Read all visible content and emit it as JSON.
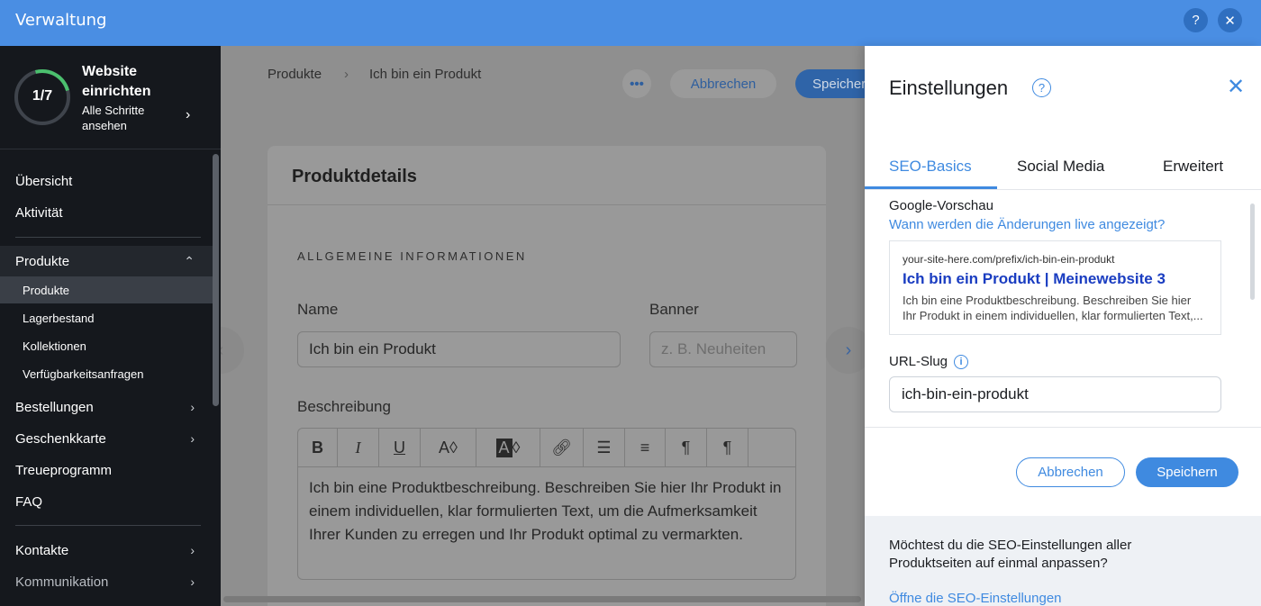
{
  "topbar": {
    "title": "Verwaltung",
    "help_icon": "?",
    "close_icon": "✕"
  },
  "sidebar": {
    "setup": {
      "progress": "1/7",
      "progress_fraction": 0.143,
      "title": "Website einrichten",
      "subtitle": "Alle Schritte ansehen"
    },
    "items": [
      {
        "label": "Übersicht"
      },
      {
        "label": "Aktivität"
      },
      {
        "label": "Produkte"
      },
      {
        "label": "Bestellungen"
      },
      {
        "label": "Geschenkkarte"
      },
      {
        "label": "Treueprogramm"
      },
      {
        "label": "FAQ"
      },
      {
        "label": "Kontakte"
      },
      {
        "label": "Kommunikation"
      }
    ],
    "subitems": [
      {
        "label": "Produkte"
      },
      {
        "label": "Lagerbestand"
      },
      {
        "label": "Kollektionen"
      },
      {
        "label": "Verfügbarkeitsanfragen"
      }
    ]
  },
  "main": {
    "breadcrumb": {
      "root": "Produkte",
      "current": "Ich bin ein Produkt"
    },
    "cancel_label": "Abbrechen",
    "save_label": "Speichern",
    "card_title": "Produktdetails",
    "section_label": "ALLGEMEINE INFORMATIONEN",
    "name_label": "Name",
    "name_value": "Ich bin ein Produkt",
    "banner_label": "Banner",
    "banner_placeholder": "z. B. Neuheiten",
    "description_label": "Beschreibung",
    "description_text": "Ich bin eine Produktbeschreibung. Beschreiben Sie hier Ihr Produkt in einem individuellen, klar formulierten Text, um die Aufmerksamkeit Ihrer Kunden zu erregen und Ihr Produkt optimal zu vermarkten."
  },
  "panel": {
    "title": "Einstellungen",
    "tabs": [
      {
        "label": "SEO-Basics"
      },
      {
        "label": "Social Media"
      },
      {
        "label": "Erweitert"
      }
    ],
    "google_preview_label": "Google-Vorschau",
    "live_link": "Wann werden die Änderungen live angezeigt?",
    "preview": {
      "url": "your-site-here.com/prefix/ich-bin-ein-produkt",
      "title": "Ich bin ein Produkt | Meinewebsite 3",
      "desc_line1": "Ich bin eine Produktbeschreibung. Beschreiben Sie hier",
      "desc_line2": "Ihr Produkt in einem individuellen, klar formulierten Text,..."
    },
    "slug_label": "URL-Slug",
    "slug_value": "ich-bin-ein-produkt",
    "cancel_label": "Abbrechen",
    "save_label": "Speichern",
    "footer_text": "Möchtest du die SEO-Einstellungen aller Produktseiten auf einmal anpassen?",
    "footer_link": "Öffne die SEO-Einstellungen"
  },
  "colors": {
    "topbar": "#4a8ee3",
    "accent": "#3f8ae0",
    "sidebar": "#15181d",
    "progress": "#4bc06e"
  }
}
